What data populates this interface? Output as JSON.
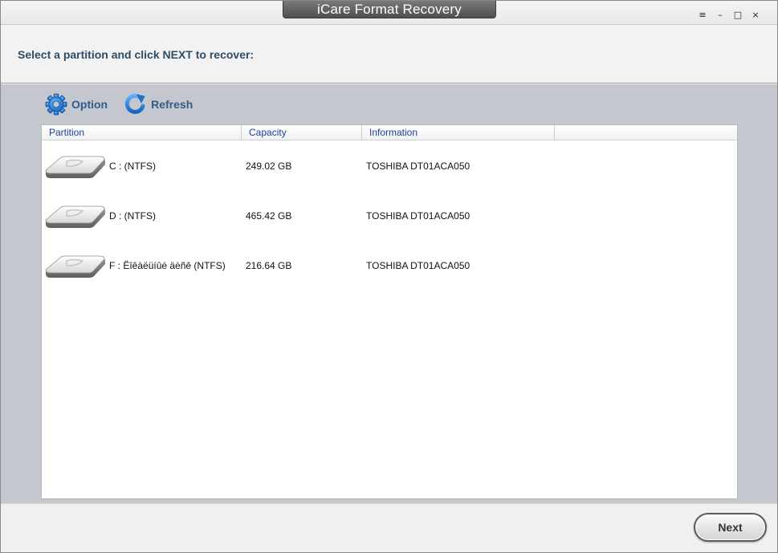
{
  "window": {
    "title": "iCare Format Recovery",
    "controls": {
      "menu": "≡",
      "minimize": "–",
      "maximize": "□",
      "close": "×"
    }
  },
  "instruction": "Select a partition and click NEXT to recover:",
  "toolbar": {
    "option_label": "Option",
    "refresh_label": "Refresh"
  },
  "table": {
    "columns": [
      "Partition",
      "Capacity",
      "Information",
      ""
    ],
    "rows": [
      {
        "partition": "C :   (NTFS)",
        "capacity": "249.02 GB",
        "information": "TOSHIBA DT01ACA050"
      },
      {
        "partition": "D :   (NTFS)",
        "capacity": "465.42 GB",
        "information": "TOSHIBA DT01ACA050"
      },
      {
        "partition": "F : Ëîêàëüíûé äèñê  (NTFS)",
        "capacity": "216.64 GB",
        "information": "TOSHIBA DT01ACA050"
      }
    ]
  },
  "footer": {
    "next_label": "Next"
  },
  "colors": {
    "accent": "#2f5c8a",
    "panel": "#c4c8ce",
    "header_text": "#1c3f9e"
  }
}
